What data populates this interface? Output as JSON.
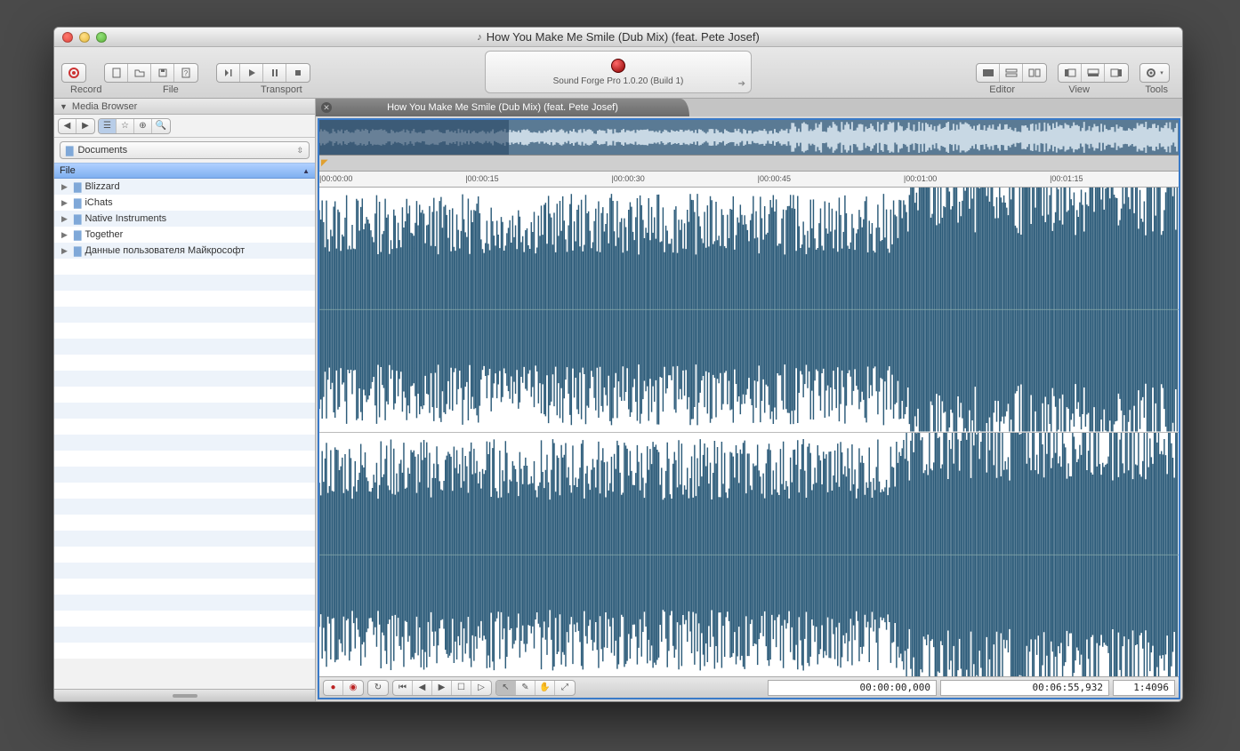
{
  "window": {
    "title": "How You Make Me Smile (Dub Mix) (feat. Pete Josef)"
  },
  "toolbar": {
    "labels": {
      "record": "Record",
      "file": "File",
      "transport": "Transport",
      "editor": "Editor",
      "view": "View",
      "tools": "Tools"
    },
    "center": {
      "version": "Sound Forge Pro 1.0.20 (Build 1)"
    }
  },
  "sidebar": {
    "panel_title": "Media Browser",
    "dropdown": {
      "label": "Documents"
    },
    "file_header": "File",
    "items": [
      {
        "label": "Blizzard"
      },
      {
        "label": "iChats"
      },
      {
        "label": "Native Instruments"
      },
      {
        "label": "Together"
      },
      {
        "label": "Данные пользователя Майкрософт"
      }
    ]
  },
  "editor": {
    "tab_title": "How You Make Me Smile (Dub Mix) (feat. Pete Josef)",
    "ruler": [
      "|00:00:00",
      "|00:00:15",
      "|00:00:30",
      "|00:00:45",
      "|00:01:00",
      "|00:01:15"
    ],
    "status": {
      "position": "00:00:00,000",
      "duration": "00:06:55,932",
      "zoom": "1:4096"
    }
  }
}
